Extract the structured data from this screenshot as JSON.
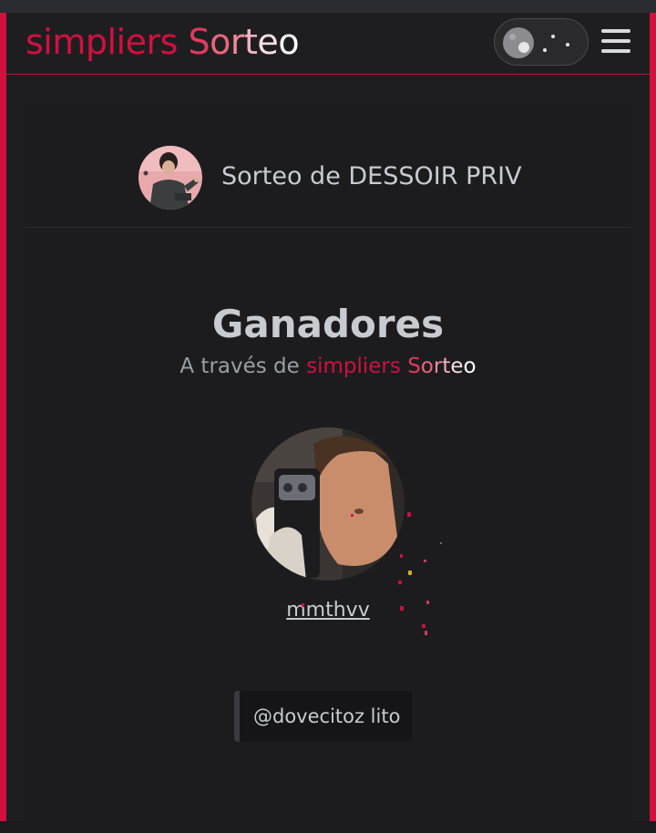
{
  "navbar": {
    "brand_word1": "simpliers",
    "brand_word2": [
      "S",
      "o",
      "r",
      "t",
      "e",
      "o"
    ],
    "theme_toggle": "dark-mode-toggle",
    "menu_icon": "hamburger-menu-icon"
  },
  "card": {
    "host_title": "Sorteo de DESSOIR PRIV",
    "winners_title": "Ganadores",
    "subtitle_prefix": "A través de",
    "subtitle_brand_word1": "simpliers",
    "subtitle_brand_word2": [
      "S",
      "o",
      "r",
      "t",
      "e",
      "o"
    ],
    "winner_name": "mmthvv",
    "winner_comment": "@dovecitoz lito"
  },
  "colors": {
    "brand_red": "#d2103e",
    "background": "#1e1e20",
    "text": "#c8cbd0"
  }
}
